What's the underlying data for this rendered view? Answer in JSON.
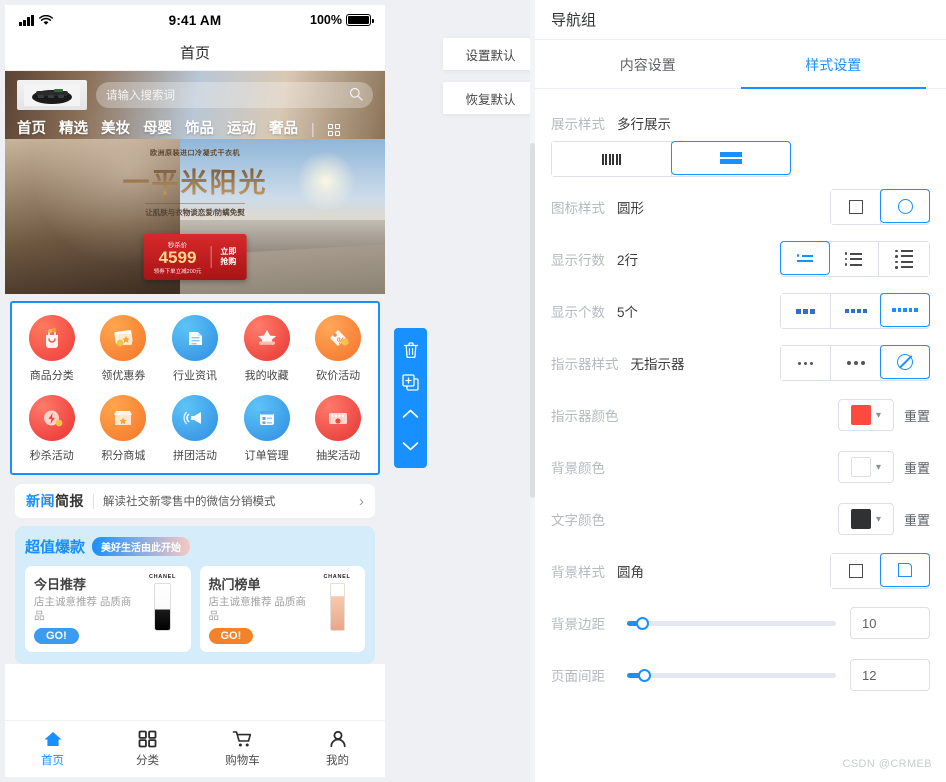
{
  "phone": {
    "status": {
      "time": "9:41 AM",
      "battery_pct": "100%"
    },
    "nav_title": "首页",
    "search": {
      "placeholder": "请输入搜索词",
      "icon": "search-icon"
    },
    "categories": [
      {
        "label": "首页",
        "active": true
      },
      {
        "label": "精选",
        "active": false
      },
      {
        "label": "美妆",
        "active": false
      },
      {
        "label": "母婴",
        "active": false
      },
      {
        "label": "饰品",
        "active": false
      },
      {
        "label": "运动",
        "active": false
      },
      {
        "label": "奢品",
        "active": false
      }
    ],
    "banner": {
      "eyebrow": "欧洲原装进口冷凝式干衣机",
      "title": "一平米阳光",
      "subtitle": "让肌肤与衣物谈恋爱/防螨免熨",
      "price_label": "秒杀价",
      "price": "4599",
      "price_note": "领券下单立减200元",
      "cta_line1": "立即",
      "cta_line2": "抢购"
    },
    "nav_group": {
      "rows": [
        [
          {
            "label": "商品分类",
            "icon": "shopping-bag-icon"
          },
          {
            "label": "领优惠券",
            "icon": "coupon-icon"
          },
          {
            "label": "行业资讯",
            "icon": "news-document-icon"
          },
          {
            "label": "我的收藏",
            "icon": "favorite-star-icon"
          },
          {
            "label": "砍价活动",
            "icon": "discount-tag-icon"
          }
        ],
        [
          {
            "label": "秒杀活动",
            "icon": "flash-sale-icon"
          },
          {
            "label": "积分商城",
            "icon": "points-store-icon"
          },
          {
            "label": "拼团活动",
            "icon": "megaphone-icon"
          },
          {
            "label": "订单管理",
            "icon": "order-list-icon"
          },
          {
            "label": "抽奖活动",
            "icon": "lottery-icon"
          }
        ]
      ]
    },
    "news": {
      "badge_1": "新闻",
      "badge_2": "简报",
      "text": "解读社交新零售中的微信分销模式",
      "arrow": "chevron-right-icon"
    },
    "promo": {
      "title": "超值爆款",
      "pill": "美好生活由此开始",
      "cards": [
        {
          "title": "今日推荐",
          "desc": "店主诚意推荐 品质商品",
          "cta": "GO!",
          "brand": "CHANEL"
        },
        {
          "title": "热门榜单",
          "desc": "店主诚意推荐 品质商品",
          "cta": "GO!",
          "brand": "CHANEL"
        }
      ]
    },
    "tabbar": [
      {
        "label": "首页",
        "icon": "home-icon",
        "active": true
      },
      {
        "label": "分类",
        "icon": "grid-icon",
        "active": false
      },
      {
        "label": "购物车",
        "icon": "cart-icon",
        "active": false
      },
      {
        "label": "我的",
        "icon": "user-icon",
        "active": false
      }
    ]
  },
  "float_buttons": [
    {
      "label": "设置默认"
    },
    {
      "label": "恢复默认"
    }
  ],
  "toolbar": [
    {
      "icon": "trash-icon",
      "name": "delete"
    },
    {
      "icon": "copy-icon",
      "name": "duplicate"
    },
    {
      "icon": "chevron-up-icon",
      "name": "move-up"
    },
    {
      "icon": "chevron-down-icon",
      "name": "move-down"
    }
  ],
  "panel": {
    "title": "导航组",
    "tabs": [
      {
        "label": "内容设置",
        "active": false
      },
      {
        "label": "样式设置",
        "active": true
      }
    ],
    "rows": {
      "display_style": {
        "label": "展示样式",
        "value": "多行展示",
        "selected_index": 1
      },
      "icon_style": {
        "label": "图标样式",
        "value": "圆形",
        "selected_index": 1
      },
      "row_count": {
        "label": "显示行数",
        "value": "2行",
        "selected_index": 0
      },
      "item_count": {
        "label": "显示个数",
        "value": "5个",
        "selected_index": 2
      },
      "indicator_style": {
        "label": "指示器样式",
        "value": "无指示器",
        "selected_index": 2
      },
      "indicator_color": {
        "label": "指示器颜色",
        "color": "#fc4a3f",
        "reset": "重置"
      },
      "background_color": {
        "label": "背景颜色",
        "color": "",
        "reset": "重置"
      },
      "text_color": {
        "label": "文字颜色",
        "color": "#303133",
        "reset": "重置"
      },
      "background_style": {
        "label": "背景样式",
        "value": "圆角",
        "selected_index": 1
      },
      "background_margin": {
        "label": "背景边距",
        "number": "10",
        "percent": 7
      },
      "page_spacing": {
        "label": "页面间距",
        "number": "12",
        "percent": 8
      }
    }
  },
  "watermark": "CSDN @CRMEB",
  "colors": {
    "accent": "#1890ff",
    "red": "#fc4a3f",
    "dark": "#303133",
    "page_bg": "#eef0f4"
  }
}
